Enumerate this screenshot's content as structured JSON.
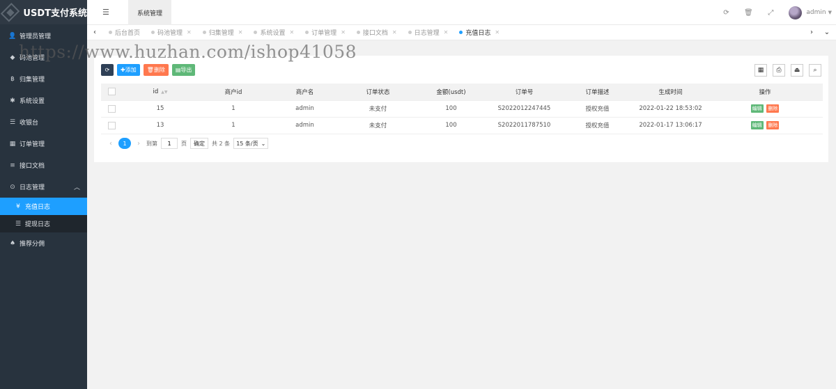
{
  "app": {
    "title": "USDT支付系统"
  },
  "sidebar": {
    "items": [
      {
        "icon": "user-icon",
        "glyph": "👤",
        "label": "管理员管理"
      },
      {
        "icon": "diamond-icon",
        "glyph": "◆",
        "label": "码池管理"
      },
      {
        "icon": "bitcoin-icon",
        "glyph": "฿",
        "label": "归集管理"
      },
      {
        "icon": "gear-icon",
        "glyph": "✱",
        "label": "系统设置"
      },
      {
        "icon": "list-icon",
        "glyph": "☰",
        "label": "收银台"
      },
      {
        "icon": "calculator-icon",
        "glyph": "▦",
        "label": "订单管理"
      },
      {
        "icon": "doc-icon",
        "glyph": "≡",
        "label": "接口文档"
      },
      {
        "icon": "clock-icon",
        "glyph": "⊙",
        "label": "日志管理"
      }
    ],
    "sub_items": [
      {
        "icon": "yen-icon",
        "glyph": "¥",
        "label": "充值日志"
      },
      {
        "icon": "list-icon",
        "glyph": "☰",
        "label": "提现日志"
      }
    ],
    "last_item": {
      "icon": "android-icon",
      "glyph": "♠",
      "label": "推荐分佣"
    }
  },
  "header": {
    "top_tab": "系统管理",
    "user": "admin"
  },
  "tabs": [
    {
      "label": "后台首页"
    },
    {
      "label": "码池管理"
    },
    {
      "label": "归集管理"
    },
    {
      "label": "系统设置"
    },
    {
      "label": "订单管理"
    },
    {
      "label": "接口文档"
    },
    {
      "label": "日志管理"
    },
    {
      "label": "充值日志"
    }
  ],
  "watermark": "https://www.huzhan.com/ishop41058",
  "toolbar": {
    "add": "添加",
    "delete": "删除",
    "export": "导出"
  },
  "table": {
    "columns": [
      "id",
      "商户id",
      "商户名",
      "订单状态",
      "金额(usdt)",
      "订单号",
      "订单描述",
      "生成时间",
      "操作"
    ],
    "rows": [
      [
        "15",
        "1",
        "admin",
        "未支付",
        "100",
        "S2022012247445",
        "授权充值",
        "2022-01-22 18:53:02"
      ],
      [
        "13",
        "1",
        "admin",
        "未支付",
        "100",
        "S2022011787510",
        "授权充值",
        "2022-01-17 13:06:17"
      ]
    ],
    "edit_label": "编辑",
    "remove_label": "删除"
  },
  "pager": {
    "current": "1",
    "goto_label": "到第",
    "goto_value": "1",
    "page_label": "页",
    "confirm": "确定",
    "total": "共 2 条",
    "page_size": "15 条/页"
  }
}
